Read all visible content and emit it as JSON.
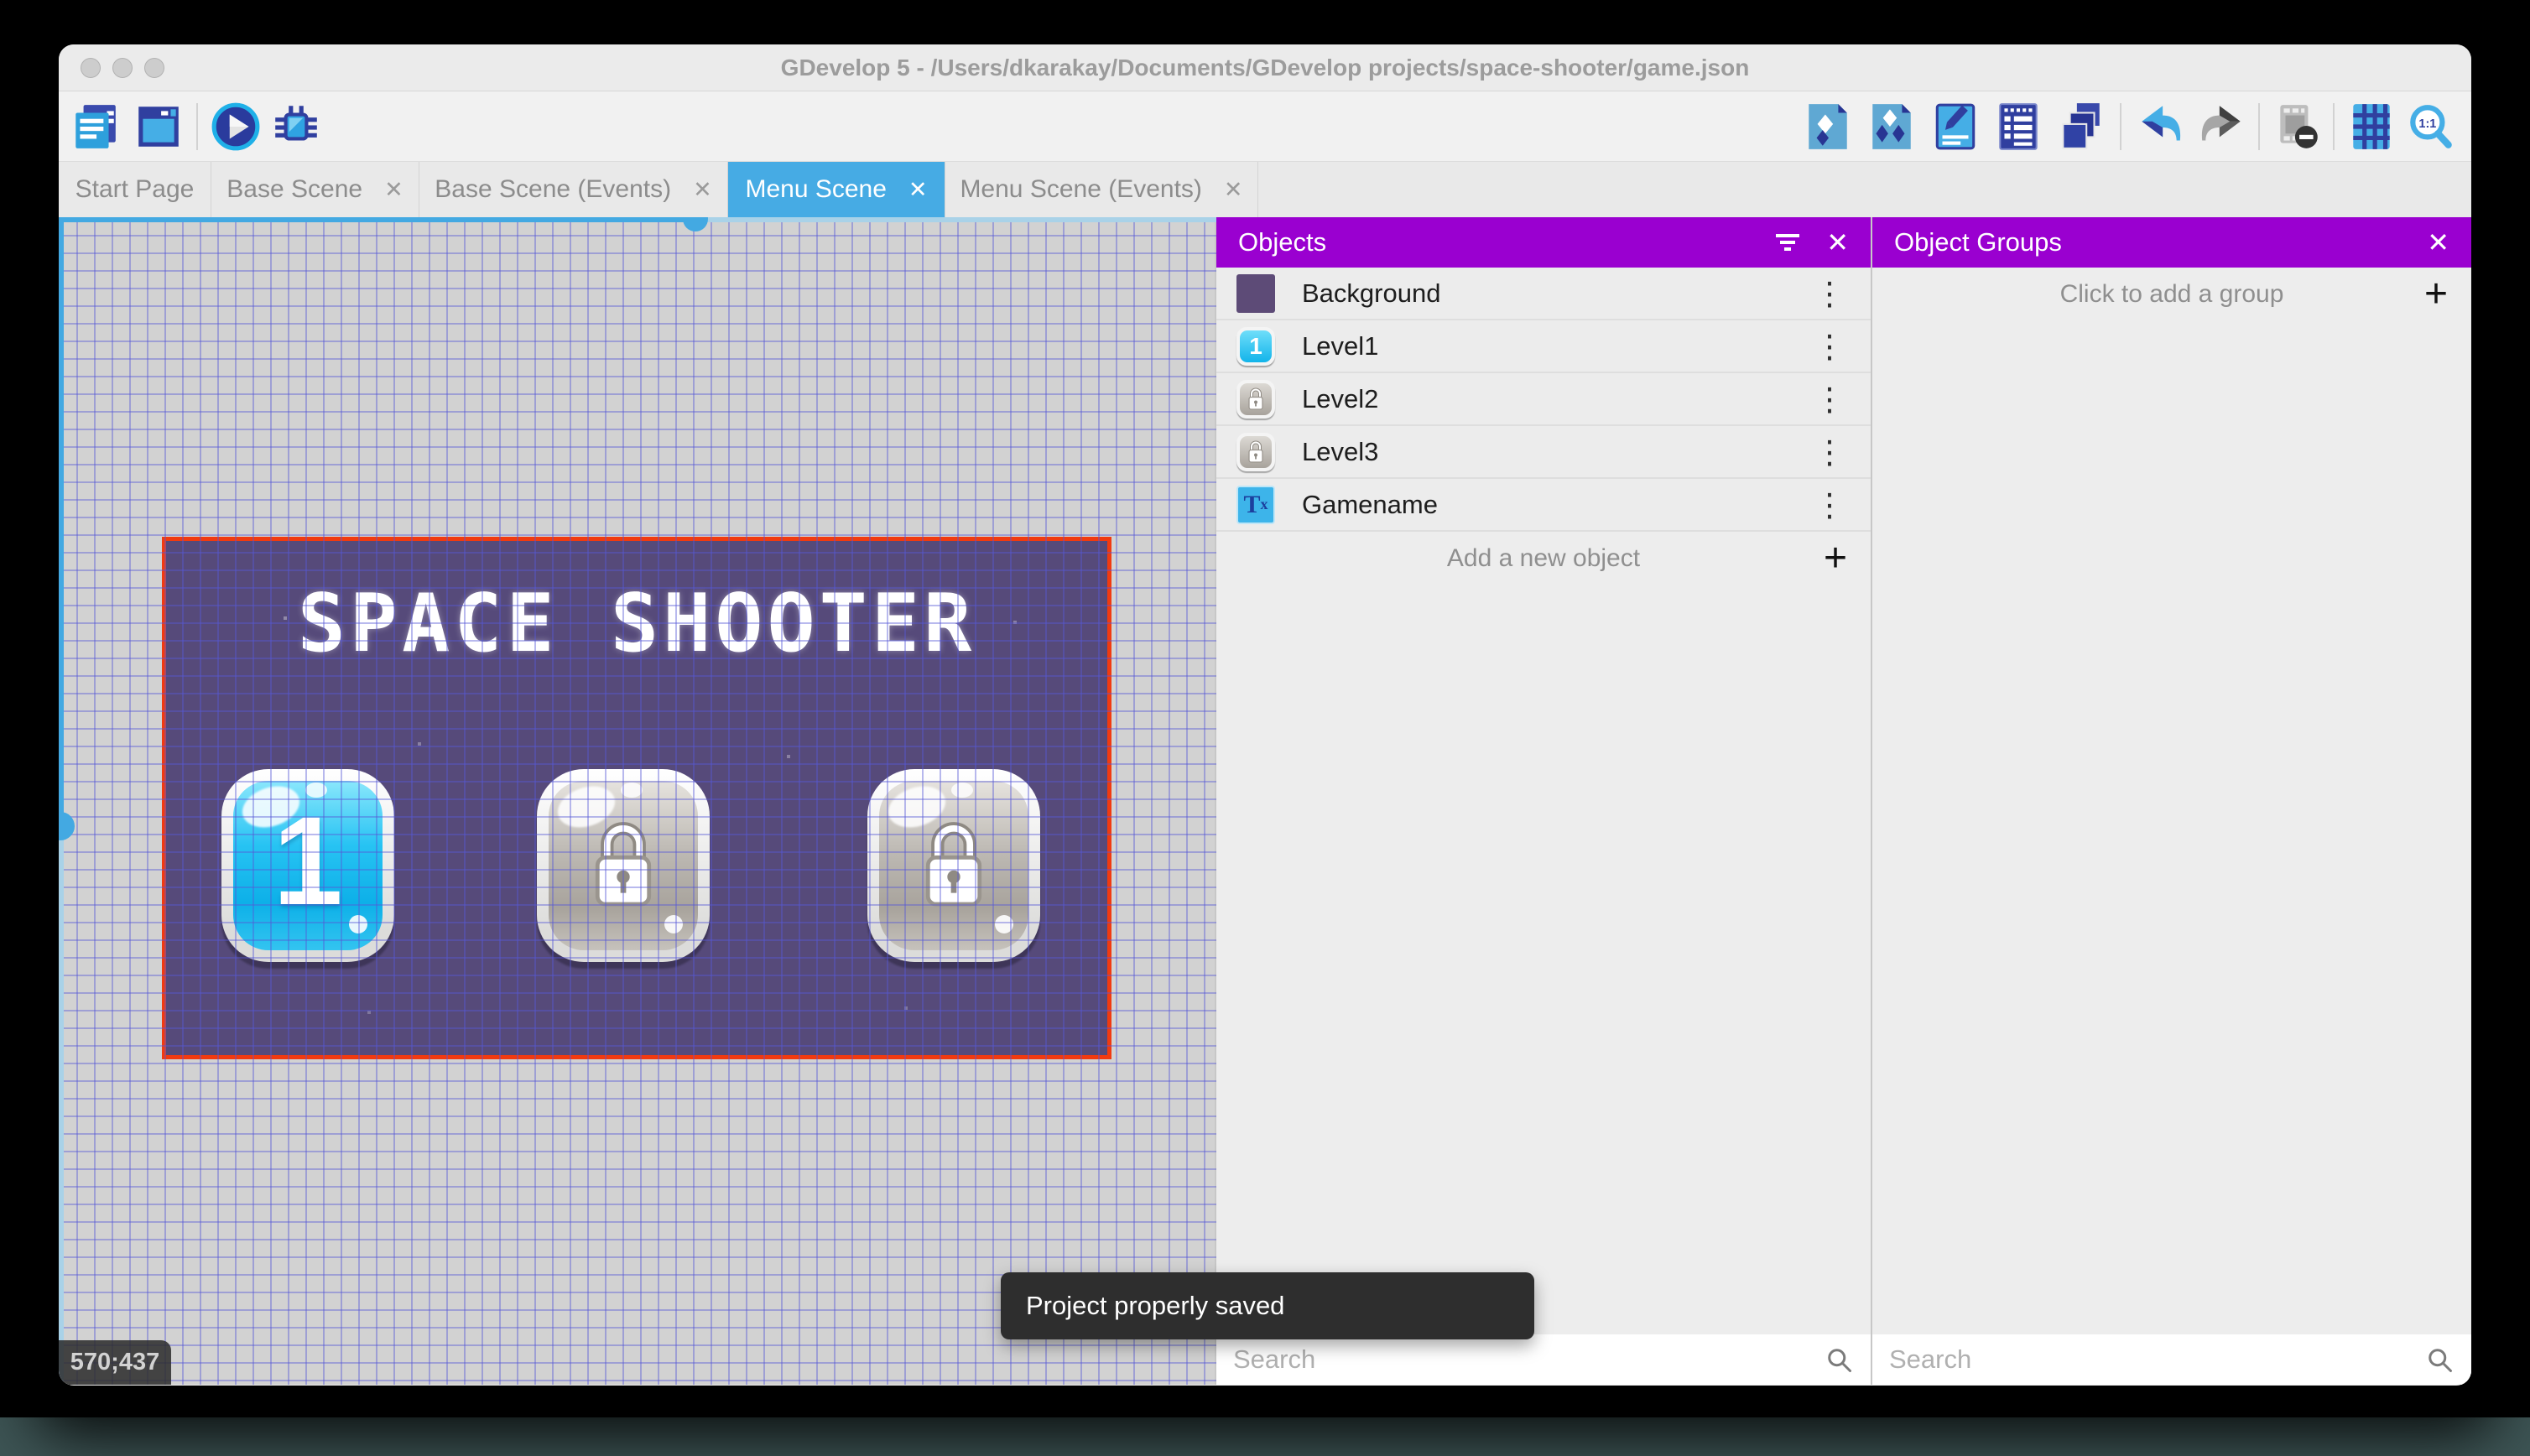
{
  "window": {
    "title": "GDevelop 5 - /Users/dkarakay/Documents/GDevelop projects/space-shooter/game.json"
  },
  "titlebar": {
    "traffic_lights": [
      "close",
      "minimize",
      "zoom"
    ]
  },
  "toolbar": {
    "left_icons": [
      "project-manager",
      "preview-window",
      "play-preview",
      "debug"
    ],
    "right_icons": [
      "objects-list",
      "object-groups",
      "properties",
      "instances-list",
      "layers",
      "undo",
      "redo",
      "toggle-instances-mask",
      "grid",
      "zoom-one-to-one"
    ]
  },
  "tabs": [
    {
      "label": "Start Page",
      "active": false,
      "closable": false
    },
    {
      "label": "Base Scene",
      "active": false,
      "closable": true
    },
    {
      "label": "Base Scene (Events)",
      "active": false,
      "closable": true
    },
    {
      "label": "Menu Scene",
      "active": true,
      "closable": true
    },
    {
      "label": "Menu Scene (Events)",
      "active": false,
      "closable": true
    }
  ],
  "canvas": {
    "cursor_coordinates": "570;437",
    "scene": {
      "title": "SPACE SHOOTER",
      "level_buttons": [
        {
          "label": "1",
          "state": "unlocked"
        },
        {
          "label": "",
          "state": "locked"
        },
        {
          "label": "",
          "state": "locked"
        }
      ]
    }
  },
  "toast": {
    "message": "Project properly saved"
  },
  "objects_panel": {
    "title": "Objects",
    "items": [
      {
        "name": "Background",
        "icon": "background-thumbnail"
      },
      {
        "name": "Level1",
        "icon": "level-1-button-thumbnail"
      },
      {
        "name": "Level2",
        "icon": "locked-button-thumbnail"
      },
      {
        "name": "Level3",
        "icon": "locked-button-thumbnail"
      },
      {
        "name": "Gamename",
        "icon": "text-object-thumbnail"
      }
    ],
    "add_label": "Add a new object",
    "search_placeholder": "Search"
  },
  "groups_panel": {
    "title": "Object Groups",
    "add_label": "Click to add a group",
    "search_placeholder": "Search"
  },
  "colors": {
    "accent_blue": "#46abe4",
    "panel_purple": "#9a00d0",
    "selection_red": "#f13a10",
    "scene_purple": "#564a7a",
    "canvas_gray": "#d2d2d2",
    "toast_dark": "#2e2e2e"
  }
}
